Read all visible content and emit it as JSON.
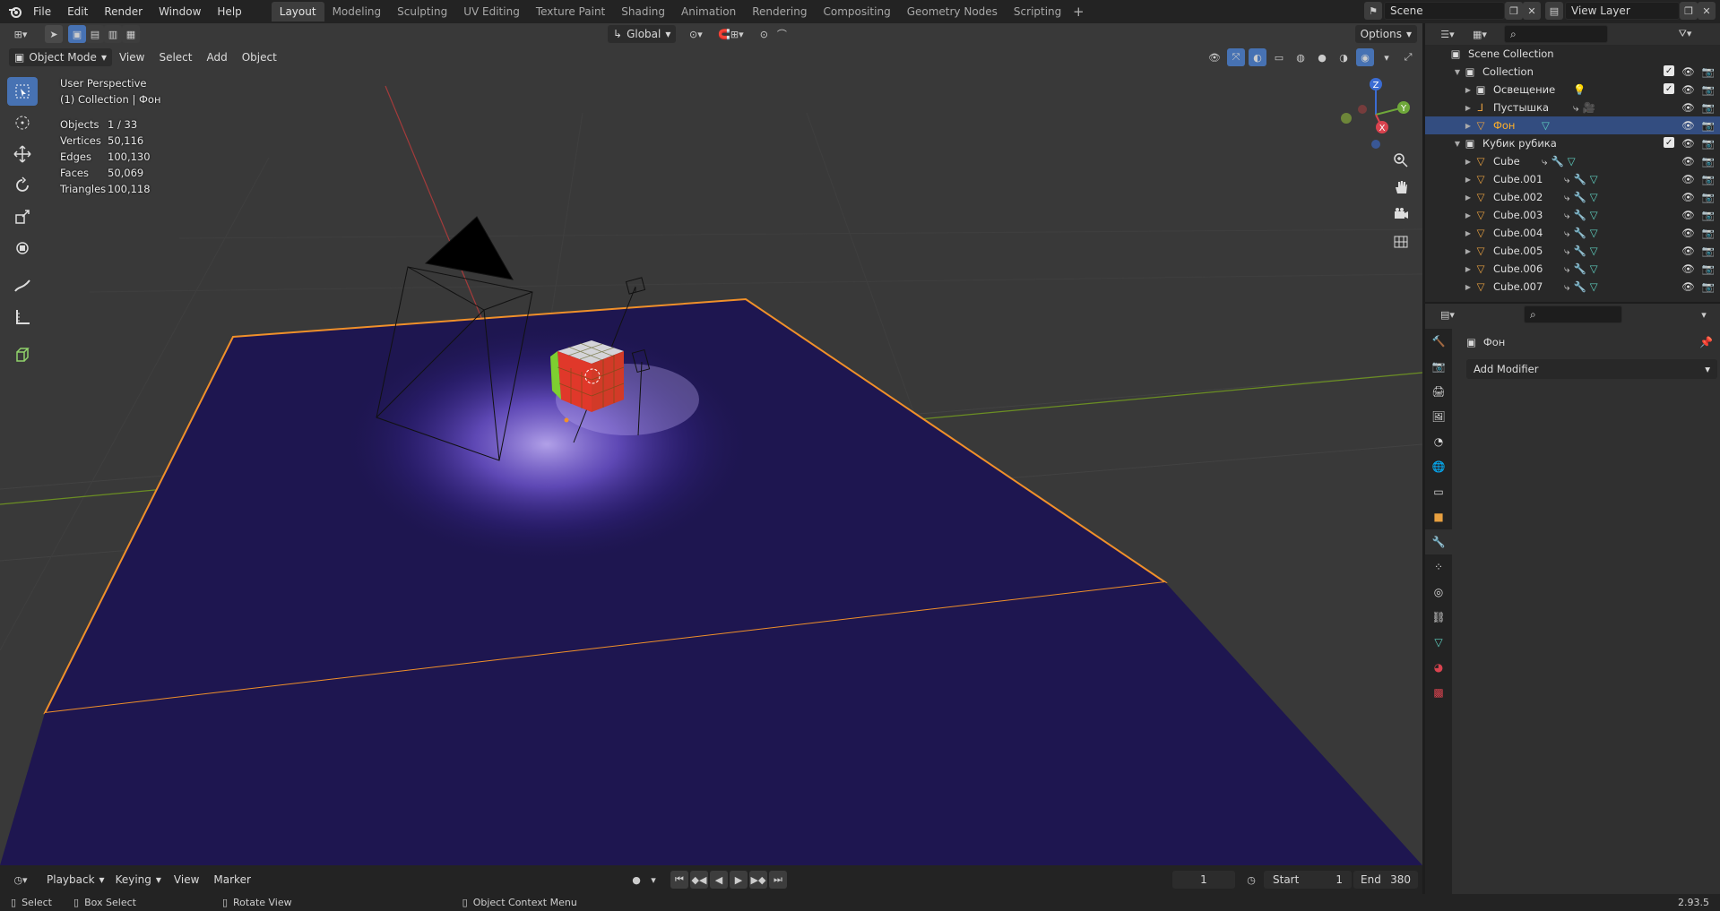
{
  "topbar": {
    "menus": [
      "File",
      "Edit",
      "Render",
      "Window",
      "Help"
    ],
    "workspaces": [
      "Layout",
      "Modeling",
      "Sculpting",
      "UV Editing",
      "Texture Paint",
      "Shading",
      "Animation",
      "Rendering",
      "Compositing",
      "Geometry Nodes",
      "Scripting"
    ],
    "active_workspace": "Layout",
    "scene": "Scene",
    "view_layer": "View Layer"
  },
  "viewport": {
    "mode": "Object Mode",
    "menus": [
      "View",
      "Select",
      "Add",
      "Object"
    ],
    "orientation": "Global",
    "options_label": "Options",
    "perspective": "User Perspective",
    "collection_info": "(1) Collection | Фон",
    "stats": [
      {
        "label": "Objects",
        "value": "1 / 33"
      },
      {
        "label": "Vertices",
        "value": "50,116"
      },
      {
        "label": "Edges",
        "value": "100,130"
      },
      {
        "label": "Faces",
        "value": "50,069"
      },
      {
        "label": "Triangles",
        "value": "100,118"
      }
    ],
    "gizmo_axes": {
      "x": "X",
      "y": "Y",
      "z": "Z"
    },
    "colors": {
      "background": "#393939",
      "plane": "#1e1650",
      "selection": "#f0902a",
      "x_axis": "#a33b3b",
      "y_axis": "#6b8e23"
    }
  },
  "timeline": {
    "menus": [
      "Playback",
      "Keying",
      "View",
      "Marker"
    ],
    "current_frame": "1",
    "start_label": "Start",
    "start": "1",
    "end_label": "End",
    "end": "380"
  },
  "statusbar": {
    "select": "Select",
    "box_select": "Box Select",
    "rotate": "Rotate View",
    "context_menu": "Object Context Menu",
    "version": "2.93.5"
  },
  "outliner": {
    "scene_collection": "Scene Collection",
    "rows": [
      {
        "name": "Collection",
        "depth": 1,
        "type": "collection",
        "expanded": true
      },
      {
        "name": "Освещение",
        "depth": 2,
        "type": "collection"
      },
      {
        "name": "Пустышка",
        "depth": 2,
        "type": "empty"
      },
      {
        "name": "Фон",
        "depth": 2,
        "type": "mesh",
        "selected": true
      },
      {
        "name": "Кубик рубика",
        "depth": 1,
        "type": "collection",
        "expanded": true
      },
      {
        "name": "Cube",
        "depth": 2,
        "type": "mesh"
      },
      {
        "name": "Cube.001",
        "depth": 2,
        "type": "mesh"
      },
      {
        "name": "Cube.002",
        "depth": 2,
        "type": "mesh"
      },
      {
        "name": "Cube.003",
        "depth": 2,
        "type": "mesh"
      },
      {
        "name": "Cube.004",
        "depth": 2,
        "type": "mesh"
      },
      {
        "name": "Cube.005",
        "depth": 2,
        "type": "mesh"
      },
      {
        "name": "Cube.006",
        "depth": 2,
        "type": "mesh"
      },
      {
        "name": "Cube.007",
        "depth": 2,
        "type": "mesh"
      }
    ]
  },
  "properties": {
    "object_name": "Фон",
    "add_modifier": "Add Modifier"
  }
}
